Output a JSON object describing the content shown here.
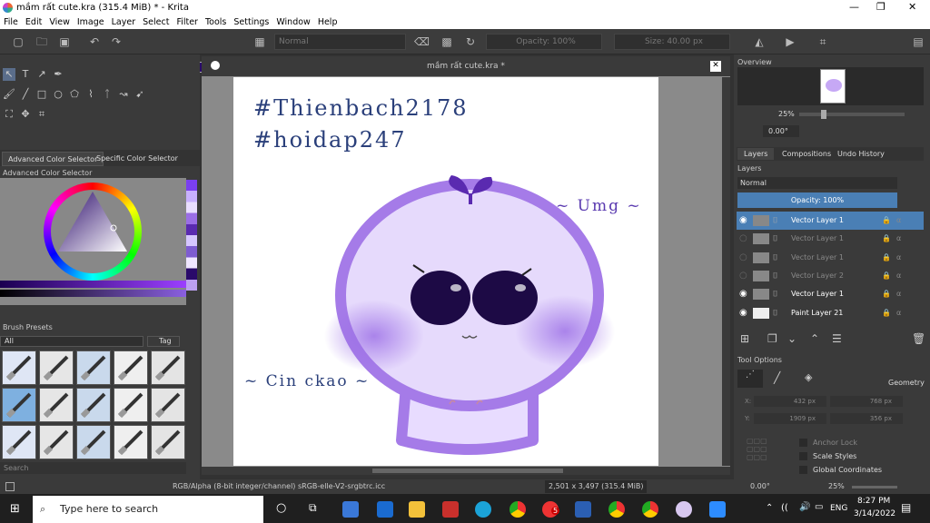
{
  "window": {
    "title": "mầm rất cute.kra (315.4 MiB)  * - Krita"
  },
  "menu": [
    "File",
    "Edit",
    "View",
    "Image",
    "Layer",
    "Select",
    "Filter",
    "Tools",
    "Settings",
    "Window",
    "Help"
  ],
  "toolbar": {
    "blend_mode": "Normal",
    "opacity": "Opacity: 100%",
    "size": "Size: 40.00 px"
  },
  "left": {
    "tabs": [
      "Advanced Color Selector",
      "Specific Color Selector"
    ],
    "color_header": "Advanced Color Selector",
    "brush_header": "Brush Presets",
    "filter": "All",
    "tag": "Tag",
    "search": "Search"
  },
  "document": {
    "title": "mầm rất cute.kra *",
    "text1": "#Thienbach2178",
    "text2": "#hoidap247",
    "text3": "~ Umg ~",
    "text4": "~ Cin ckao ~"
  },
  "right": {
    "overview": "Overview",
    "zoom": "25%",
    "rotation": "0.00°",
    "tabs": [
      "Layers",
      "Compositions",
      "Undo History"
    ],
    "layers_header": "Layers",
    "blend": "Normal",
    "opacity": "Opacity:  100%",
    "layers": [
      {
        "name": "Vector Layer 1",
        "visible": true,
        "selected": true
      },
      {
        "name": "Vector Layer 1",
        "visible": false,
        "selected": false
      },
      {
        "name": "Vector Layer 1",
        "visible": false,
        "selected": false
      },
      {
        "name": "Vector Layer 2",
        "visible": false,
        "selected": false
      },
      {
        "name": "Vector Layer 1",
        "visible": true,
        "selected": false
      },
      {
        "name": "Paint Layer 21",
        "visible": true,
        "selected": false
      }
    ],
    "tool_options": "Tool Options",
    "geometry": "Geometry",
    "x": "432 px",
    "y": "1909 px",
    "w": "768 px",
    "h": "356 px",
    "anchor": "Anchor Lock",
    "scale": "Scale Styles",
    "global": "Global Coordinates"
  },
  "status": {
    "colorspace": "RGB/Alpha (8-bit integer/channel)  sRGB-elle-V2-srgbtrc.icc",
    "dims": "2,501 x 3,497 (315.4 MiB)",
    "rotation": "0.00°",
    "zoom": "25%"
  },
  "taskbar": {
    "search": "Type here to search",
    "lang": "ENG",
    "time": "8:27 PM",
    "date": "3/14/2022",
    "badge": "5"
  },
  "colors": {
    "accent": "#4a7fb5",
    "purple": "#9b6ee6"
  }
}
